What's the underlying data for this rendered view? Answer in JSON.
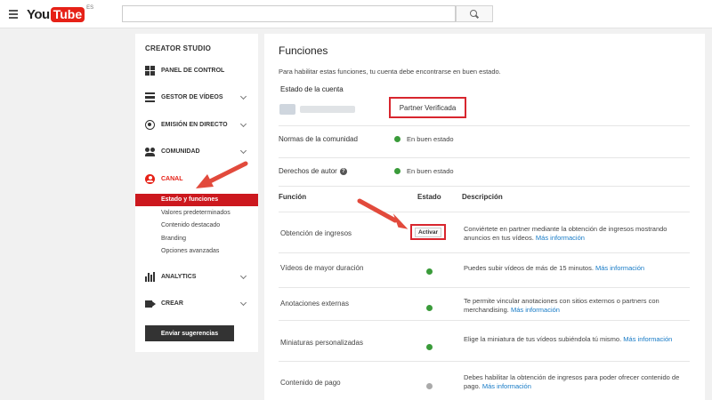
{
  "header": {
    "logo_you": "You",
    "logo_tube": "Tube",
    "logo_region": "ES",
    "search_placeholder": "",
    "menu_icon": "hamburger-icon",
    "search_icon": "search-icon"
  },
  "sidebar": {
    "title": "CREATOR STUDIO",
    "items": [
      {
        "label": "PANEL DE CONTROL",
        "icon": "dashboard-icon"
      },
      {
        "label": "GESTOR DE VÍDEOS",
        "icon": "video-manager-icon"
      },
      {
        "label": "EMISIÓN EN DIRECTO",
        "icon": "live-icon"
      },
      {
        "label": "COMUNIDAD",
        "icon": "community-icon"
      },
      {
        "label": "CANAL",
        "icon": "channel-icon"
      },
      {
        "label": "ANALYTICS",
        "icon": "analytics-icon"
      },
      {
        "label": "CREAR",
        "icon": "create-icon"
      }
    ],
    "canal_subitems": [
      "Estado y funciones",
      "Valores predeterminados",
      "Contenido destacado",
      "Branding",
      "Opciones avanzadas"
    ],
    "feedback_button": "Enviar sugerencias"
  },
  "main": {
    "title": "Funciones",
    "description": "Para habilitar estas funciones, tu cuenta debe encontrarse en buen estado.",
    "account_state_label": "Estado de la cuenta",
    "partner_status": "Partner Verificada",
    "status_rows": [
      {
        "label": "Normas de la comunidad",
        "status": "En buen estado"
      },
      {
        "label": "Derechos de autor",
        "status": "En buen estado"
      }
    ],
    "table_headers": {
      "feature": "Función",
      "state": "Estado",
      "description": "Descripción"
    },
    "features": [
      {
        "name": "Obtención de ingresos",
        "action": "Activar",
        "desc": "Conviértete en partner mediante la obtención de ingresos mostrando anuncios en tus vídeos.",
        "link": "Más información"
      },
      {
        "name": "Vídeos de mayor duración",
        "status_color": "#3a9b3a",
        "desc": "Puedes subir vídeos de más de 15 minutos.",
        "link": "Más información"
      },
      {
        "name": "Anotaciones externas",
        "status_color": "#3a9b3a",
        "desc": "Te permite vincular anotaciones con sitios externos o partners con merchandising.",
        "link": "Más información"
      },
      {
        "name": "Miniaturas personalizadas",
        "status_color": "#3a9b3a",
        "desc": "Elige la miniatura de tus vídeos subiéndola tú mismo.",
        "link": "Más información"
      },
      {
        "name": "Contenido de pago",
        "status_color": "#aaaaaa",
        "desc": "Debes habilitar la obtención de ingresos para poder ofrecer contenido de pago.",
        "link": "Más información"
      }
    ]
  },
  "colors": {
    "accent": "#e62117",
    "active_bg": "#cc181e",
    "ok": "#3a9b3a",
    "disabled": "#aaaaaa",
    "link": "#167ac6",
    "annotation": "#d8262e"
  }
}
